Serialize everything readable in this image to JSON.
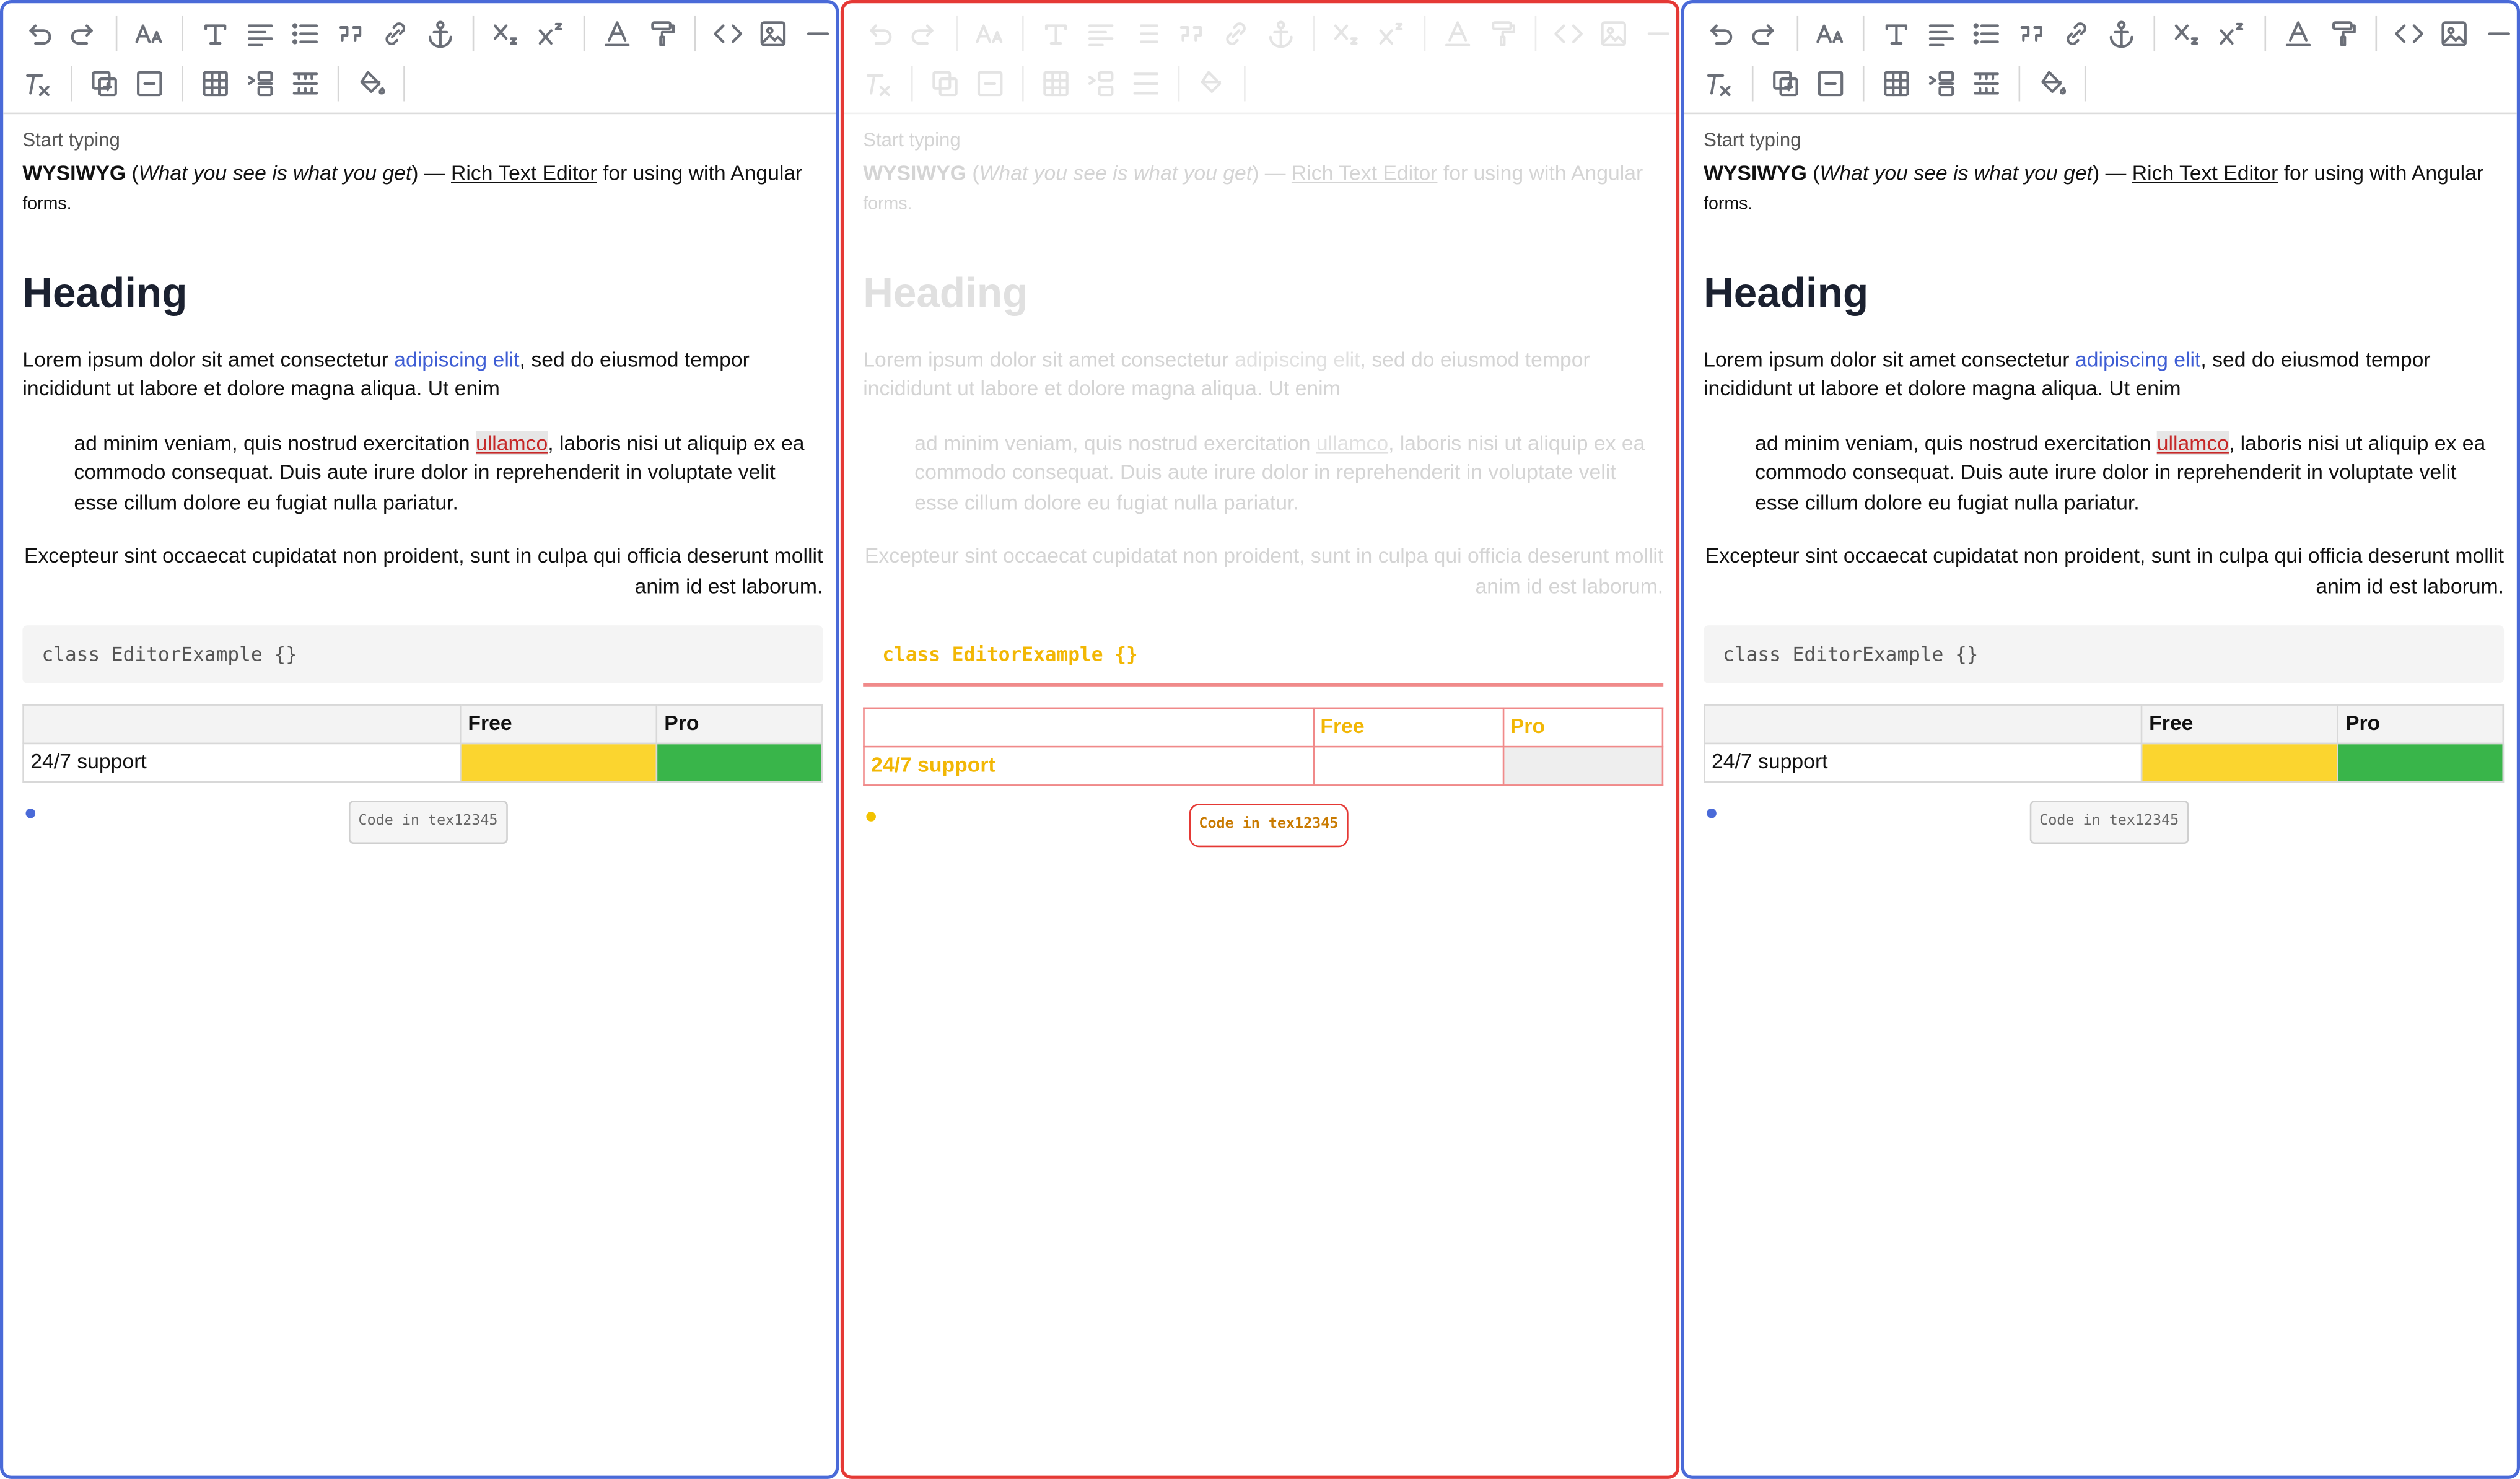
{
  "editor": {
    "placeholder": "Start typing",
    "intro": {
      "bold": "WYSIWYG",
      "open_paren": " (",
      "italic": "What you see is what you get",
      "close_dash": ") — ",
      "link": "Rich Text Editor",
      "rest": " for using with Angular",
      "small": "forms."
    },
    "heading": "Heading",
    "para1": {
      "before": "Lorem ipsum dolor sit amet consectetur ",
      "link": "adipiscing elit",
      "after": ", sed do eiusmod tempor incididunt ut labore et dolore magna aliqua. Ut enim"
    },
    "quote": {
      "before": "ad minim veniam, quis nostrud exercitation ",
      "mark": "ullamco",
      "after": ", laboris nisi ut aliquip ex ea commodo consequat. Duis aute irure dolor in reprehenderit in voluptate velit esse cillum dolore eu fugiat nulla pariatur."
    },
    "right_para": "Excepteur sint occaecat cupidatat non proident, sunt in culpa qui officia deserunt mollit anim id est laborum.",
    "code": "class EditorExample {}",
    "table": {
      "headers": [
        "",
        "Free",
        "Pro"
      ],
      "row_label": "24/7 support"
    },
    "chip": "Code in tex12345"
  },
  "toolbar_icons": {
    "row1": [
      "undo-icon",
      "redo-icon",
      "font-size-icon",
      "text-style-icon",
      "align-icon",
      "list-icon",
      "quote-icon",
      "link-icon",
      "anchor-icon",
      "subscript-icon",
      "superscript-icon",
      "text-color-icon",
      "paint-roller-icon",
      "code-icon",
      "image-icon",
      "horizontal-rule-icon"
    ],
    "row2": [
      "clear-format-icon",
      "insert-group-icon",
      "remove-group-icon",
      "table-icon",
      "row-insert-icon",
      "cell-merge-icon",
      "fill-color-icon"
    ]
  },
  "colors": {
    "panel_border": "#4a6ad8",
    "diff_border": "#e53935",
    "yellow_cell": "#fbd52f",
    "green_cell": "#39b54a",
    "link": "#3f5ed4"
  }
}
